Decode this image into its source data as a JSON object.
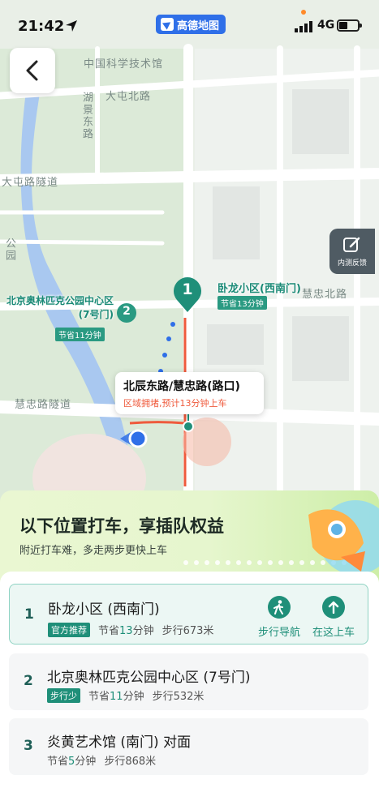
{
  "status_bar": {
    "time": "21:42",
    "app_badge": "高德地图",
    "network": "4G"
  },
  "map": {
    "labels": {
      "university": "中国科学技术馆",
      "datun_road": "大屯北路",
      "hujing_road": "湖景东路",
      "tunnel_top": "大屯路隧道",
      "park_left": "公园",
      "huizhong_north": "慧忠北路",
      "huizhong_tunnel": "慧忠路隧道"
    },
    "pins": [
      {
        "num": "1",
        "name": "卧龙小区(西南门)",
        "save": "节省13分钟"
      },
      {
        "num": "2",
        "name": "北京奥林匹克公园中心区(7号门)",
        "save": "节省11分钟"
      }
    ],
    "tooltip": {
      "title": "北辰东路/慧忠路(路口)",
      "note": "区域拥堵,预计13分钟上车"
    },
    "feedback_label": "内测反馈"
  },
  "promo": {
    "title": "以下位置打车，享插队权益",
    "subtitle": "附近打车难，多走两步更快上车"
  },
  "locations": [
    {
      "index": "1",
      "name": "卧龙小区 (西南门)",
      "tag": "官方推荐",
      "save_prefix": "节省",
      "save_num": "13",
      "save_unit": "分钟",
      "walk": "步行673米",
      "actions": [
        "步行导航",
        "在这上车"
      ]
    },
    {
      "index": "2",
      "name": "北京奥林匹克公园中心区 (7号门)",
      "tag": "步行少",
      "save_prefix": "节省",
      "save_num": "11",
      "save_unit": "分钟",
      "walk": "步行532米"
    },
    {
      "index": "3",
      "name": "炎黄艺术馆 (南门) 对面",
      "save_prefix": "节省",
      "save_num": "5",
      "save_unit": "分钟",
      "walk": "步行868米"
    }
  ],
  "colors": {
    "accent": "#1f8f79",
    "route_red": "#ef5a3c",
    "location_blue": "#2f6fe8"
  }
}
